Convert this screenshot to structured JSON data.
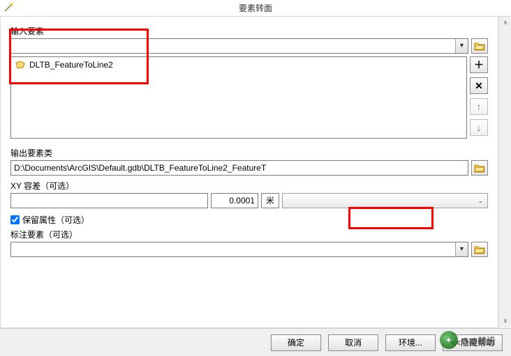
{
  "window": {
    "title": "要素转面"
  },
  "input_features": {
    "label": "输入要素",
    "value": "",
    "items": [
      "DLTB_FeatureToLine2"
    ]
  },
  "output_fc": {
    "label": "输出要素类",
    "value": "D:\\Documents\\ArcGIS\\Default.gdb\\DLTB_FeatureToLine2_FeatureT"
  },
  "xy_tolerance": {
    "label": "XY 容差（可选）",
    "value": "0.0001",
    "unit": "米"
  },
  "preserve_attr": {
    "label": "保留属性（可选）",
    "checked": true
  },
  "label_features": {
    "label": "标注要素（可选）",
    "value": ""
  },
  "buttons": {
    "ok": "确定",
    "cancel": "取消",
    "env": "环境...",
    "help": "<<隐藏帮助"
  },
  "icons": {
    "add": "＋",
    "remove": "✕",
    "up": "↑",
    "down": "↓"
  },
  "watermark": {
    "brand": "GIS前沿"
  }
}
